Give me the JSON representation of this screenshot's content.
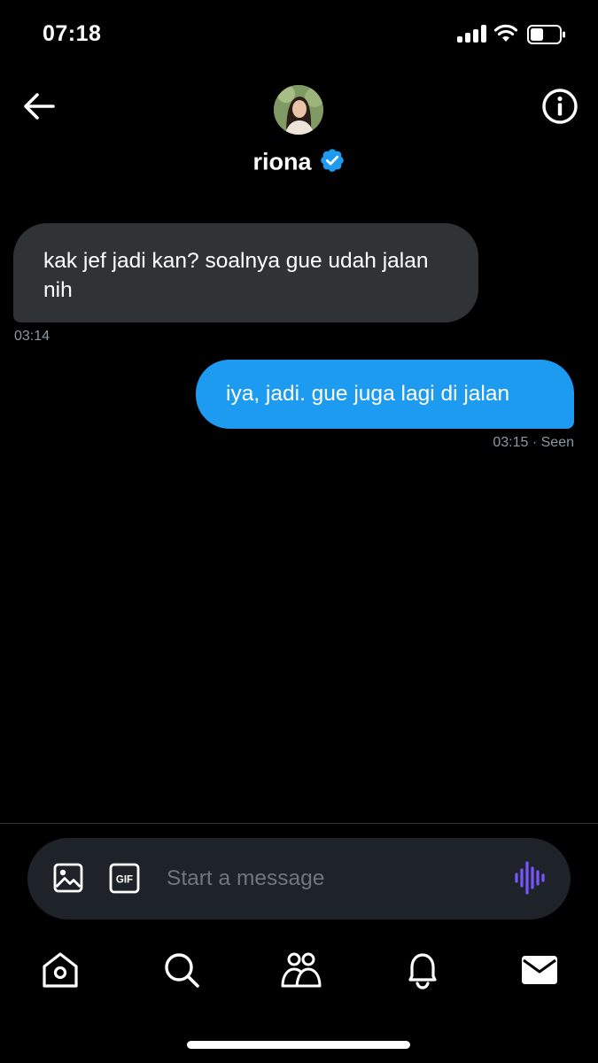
{
  "status_bar": {
    "time": "07:18"
  },
  "header": {
    "contact_name": "riona",
    "verified": true
  },
  "messages": [
    {
      "direction": "incoming",
      "text": "kak jef jadi kan? soalnya gue udah jalan nih",
      "meta": "03:14"
    },
    {
      "direction": "outgoing",
      "text": "iya, jadi. gue juga lagi di jalan",
      "meta": "03:15 · Seen"
    }
  ],
  "composer": {
    "placeholder": "Start a message",
    "value": "",
    "gif_label": "GIF"
  },
  "nav": {
    "items": [
      "home-icon",
      "search-icon",
      "communities-icon",
      "notifications-icon",
      "messages-icon"
    ],
    "active": "messages-icon"
  },
  "colors": {
    "background": "#000000",
    "incoming_bubble": "#2f3336",
    "outgoing_bubble": "#1d9bf0",
    "composer_bg": "#1e2329",
    "verified": "#1d9bf0",
    "voice_accent": "#7856ff",
    "muted_text": "#8b98a5"
  }
}
